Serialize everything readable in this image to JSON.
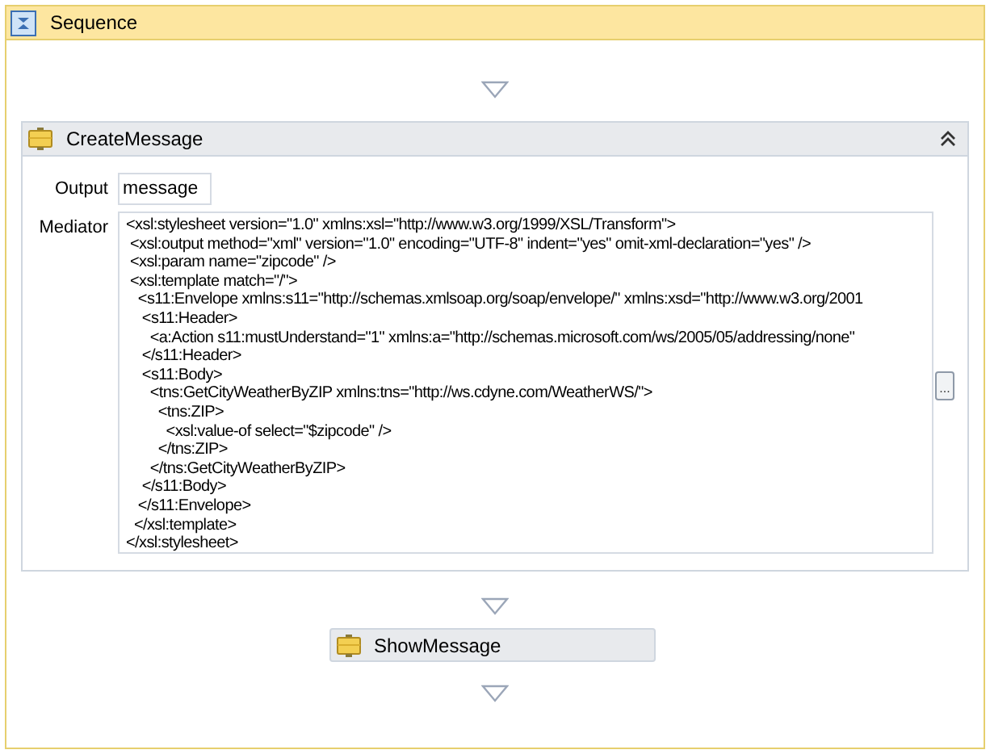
{
  "sequence": {
    "title": "Sequence"
  },
  "create_message": {
    "title": "CreateMessage",
    "expanded": true,
    "output": {
      "label": "Output",
      "value": "message"
    },
    "mediator": {
      "label": "Mediator",
      "lines": [
        "<xsl:stylesheet version=\"1.0\" xmlns:xsl=\"http://www.w3.org/1999/XSL/Transform\">",
        " <xsl:output method=\"xml\" version=\"1.0\" encoding=\"UTF-8\" indent=\"yes\" omit-xml-declaration=\"yes\" />",
        " <xsl:param name=\"zipcode\" />",
        " <xsl:template match=\"/\">",
        "   <s11:Envelope xmlns:s11=\"http://schemas.xmlsoap.org/soap/envelope/\" xmlns:xsd=\"http://www.w3.org/2001",
        "    <s11:Header>",
        "      <a:Action s11:mustUnderstand=\"1\" xmlns:a=\"http://schemas.microsoft.com/ws/2005/05/addressing/none\"",
        "    </s11:Header>",
        "    <s11:Body>",
        "      <tns:GetCityWeatherByZIP xmlns:tns=\"http://ws.cdyne.com/WeatherWS/\">",
        "        <tns:ZIP>",
        "          <xsl:value-of select=\"$zipcode\" />",
        "        </tns:ZIP>",
        "      </tns:GetCityWeatherByZIP>",
        "    </s11:Body>",
        "   </s11:Envelope>",
        "  </xsl:template>",
        "</xsl:stylesheet>"
      ],
      "button": "..."
    }
  },
  "show_message": {
    "title": "ShowMessage"
  }
}
